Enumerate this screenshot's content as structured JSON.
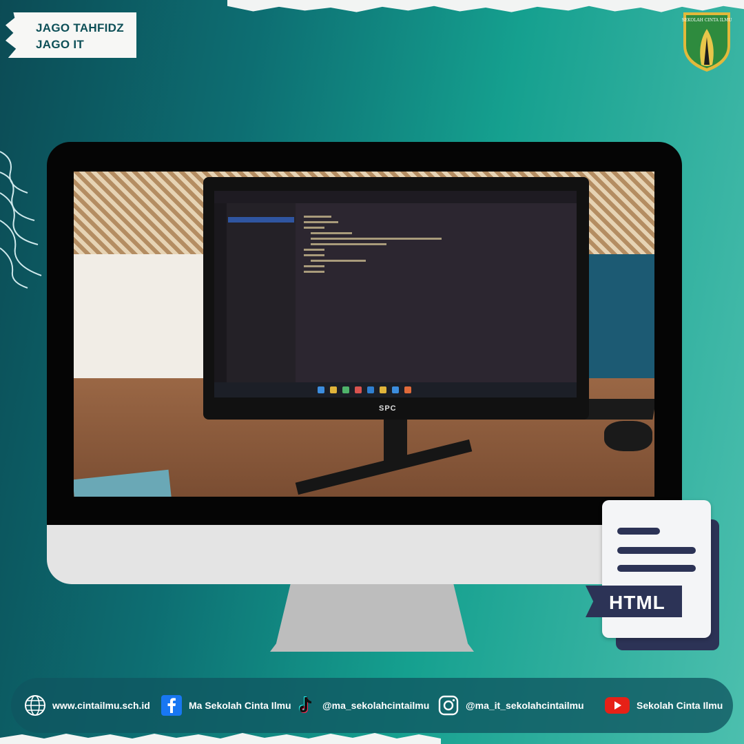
{
  "badge": {
    "line1": "JAGO TAHFIDZ",
    "line2": "JAGO IT"
  },
  "logo": {
    "text": "SEKOLAH CINTA ILMU",
    "icon": "school-shield-logo"
  },
  "monitor_photo": {
    "brand": "SPC"
  },
  "html_icon": {
    "label": "HTML"
  },
  "footer": {
    "website": "www.cintailmu.sch.id",
    "facebook": "Ma Sekolah Cinta Ilmu",
    "tiktok": "@ma_sekolahcintailmu",
    "instagram": "@ma_it_sekolahcintailmu",
    "youtube": "Sekolah Cinta Ilmu"
  },
  "colors": {
    "teal_dark": "#0c4b55",
    "teal_light": "#4cbfae",
    "navy": "#2c3356",
    "shield_green": "#2e8b3e",
    "shield_gold": "#e2b93b"
  }
}
